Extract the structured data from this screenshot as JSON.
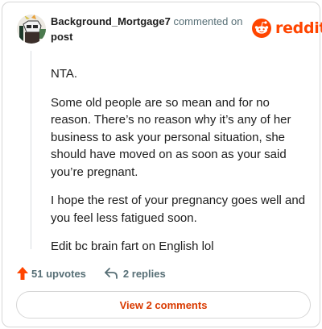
{
  "comment": {
    "username": "Background_Mortgage7",
    "action_text": "commented on",
    "post_link": "post",
    "paragraphs": [
      "NTA.",
      "Some old people are so mean and for no reason. There’s no reason why it’s any of her business to ask your personal situation, she should have moved on as soon as your said you’re pregnant.",
      "I hope the rest of your pregnancy goes well and you feel less fatigued soon.",
      "Edit bc brain fart on English lol"
    ]
  },
  "brand": {
    "wordmark": "reddit",
    "color": "#ff4500",
    "icon": "reddit-snoo-icon"
  },
  "actions": {
    "upvotes": "51 upvotes",
    "upvote_icon": "upvote-arrow-icon",
    "upvote_color": "#ff4500",
    "replies": "2 replies",
    "reply_icon": "reply-arrow-icon"
  },
  "footer": {
    "view_comments": "View 2 comments",
    "accent_color": "#d93a00"
  }
}
